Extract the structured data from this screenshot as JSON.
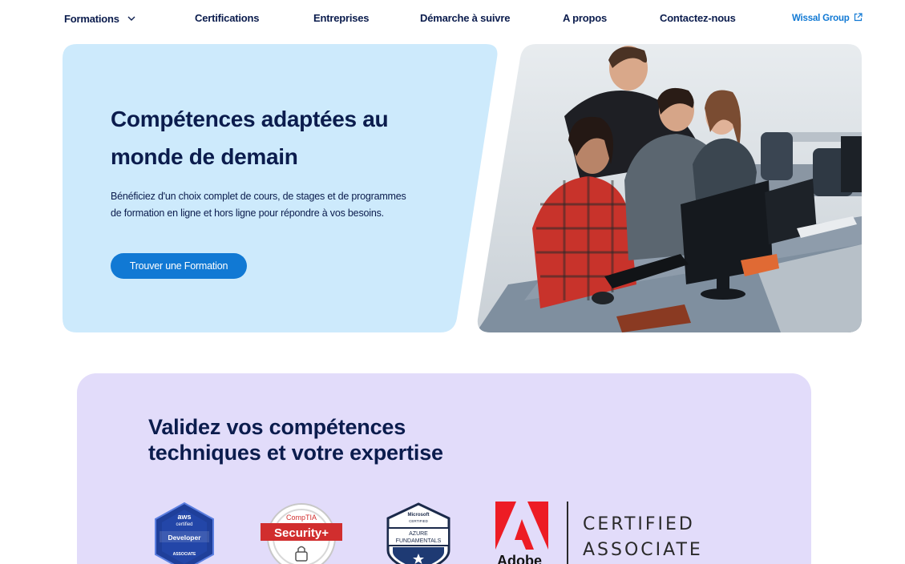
{
  "nav": {
    "items": [
      "Formations",
      "Certifications",
      "Entreprises",
      "Démarche à suivre",
      "A propos",
      "Contactez-nous"
    ],
    "external_link": "Wissal Group",
    "formations_icon": "chevron-down-icon",
    "external_icon": "external-link-icon"
  },
  "hero": {
    "title": "Compétences adaptées au monde de demain",
    "description": "Bénéficiez d'un choix complet de cours, de stages et de programmes de formation en ligne et hors ligne pour répondre à vos besoins.",
    "cta_label": "Trouver une Formation",
    "photo": "students-at-computer-photo"
  },
  "cert_section": {
    "title_line1": "Validez vos compétences",
    "title_line2": "techniques et votre expertise",
    "badges": {
      "aws": {
        "brand": "aws",
        "line2": "certified",
        "title": "Developer",
        "level": "ASSOCIATE"
      },
      "comptia": {
        "brand": "CompTIA",
        "title": "Security+"
      },
      "microsoft": {
        "brand": "Microsoft",
        "line2": "CERTIFIED",
        "line3": "AZURE",
        "line4": "FUNDAMENTALS"
      },
      "adobe": {
        "brand": "Adobe",
        "line1": "CERTIFIED",
        "line2": "ASSOCIATE"
      }
    }
  },
  "colors": {
    "navy": "#0b1c4d",
    "accent_blue": "#1179d4",
    "hero_panel": "#cdeafc",
    "cert_panel": "#e2dcfa",
    "adobe_red": "#ed1c24"
  }
}
